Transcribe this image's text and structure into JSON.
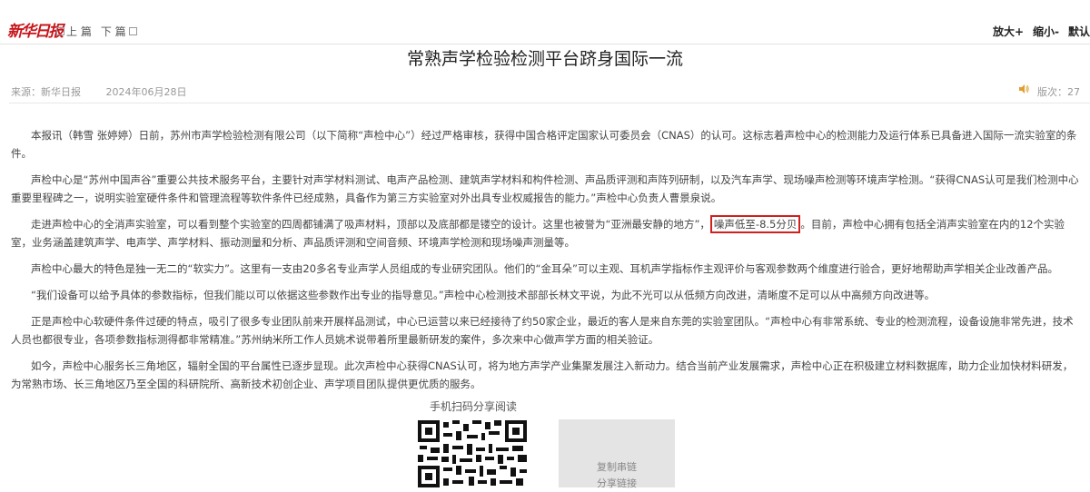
{
  "header": {
    "logo_text": "新华日报",
    "prev_label": "上 篇",
    "next_label": "下 篇",
    "zoom_in": "放大+",
    "zoom_out": "缩小-",
    "reset": "默认"
  },
  "article": {
    "title": "常熟声学检验检测平台跻身国际一流",
    "source": "来源：新华日报",
    "date": "2024年06月28日",
    "edition": "版次：27",
    "paragraphs": [
      "本报讯（韩雪 张婷婷）日前，苏州市声学检验检测有限公司（以下简称“声检中心”）经过严格审核，获得中国合格评定国家认可委员会（CNAS）的认可。这标志着声检中心的检测能力及运行体系已具备进入国际一流实验室的条件。",
      "声检中心是“苏州中国声谷”重要公共技术服务平台，主要针对声学材料测试、电声产品检测、建筑声学材料和构件检测、声品质评测和声阵列研制，以及汽车声学、现场噪声检测等环境声学检测。“获得CNAS认可是我们检测中心重要里程碑之一，说明实验室硬件条件和管理流程等软件条件已经成熟，具备作为第三方实验室对外出具专业权威报告的能力。”声检中心负责人曹景泉说。"
    ],
    "para3_before": "走进声检中心的全消声实验室，可以看到整个实验室的四周都铺满了吸声材料，顶部以及底部都是镂空的设计。这里也被誉为“亚洲最安静的地方”，",
    "para3_highlight": "噪声低至-8.5分贝",
    "para3_after": "。目前，声检中心拥有包括全消声实验室在内的12个实验室，业务涵盖建筑声学、电声学、声学材料、振动测量和分析、声品质评测和空间音频、环境声学检测和现场噪声测量等。",
    "paragraphs_rest": [
      "声检中心最大的特色是独一无二的“软实力”。这里有一支由20多名专业声学人员组成的专业研究团队。他们的“金耳朵”可以主观、耳机声学指标作主观评价与客观参数两个维度进行验合，更好地帮助声学相关企业改善产品。",
      "“我们设备可以给予具体的参数指标，但我们能以可以依据这些参数作出专业的指导意见。”声检中心检测技术部部长林文平说，为此不光可以从低频方向改进，清晰度不足可以从中高频方向改进等。",
      "正是声检中心软硬件条件过硬的特点，吸引了很多专业团队前来开展样品测试，中心已运营以来已经接待了约50家企业，最近的客人是来自东莞的实验室团队。“声检中心有非常系统、专业的检测流程，设备设施非常先进，技术人员也都很专业，各项参数指标测得都非常精准。”苏州纳米所工作人员姚术说带着所里最新研发的案件，多次来中心做声学方面的相关验证。",
      "如今，声检中心服务长三角地区，辐射全国的平台属性已逐步显现。此次声检中心获得CNAS认可，将为地方声学产业集聚发展注入新动力。结合当前产业发展需求，声检中心正在积极建立材料数据库，助力企业加快材料研发，为常熟市场、长三角地区乃至全国的科研院所、高新技术初创企业、声学项目团队提供更优质的服务。"
    ]
  },
  "share": {
    "qr_label": "手机扫码分享阅读",
    "copy_line1": "复制串链",
    "copy_line2": "分享链接"
  }
}
